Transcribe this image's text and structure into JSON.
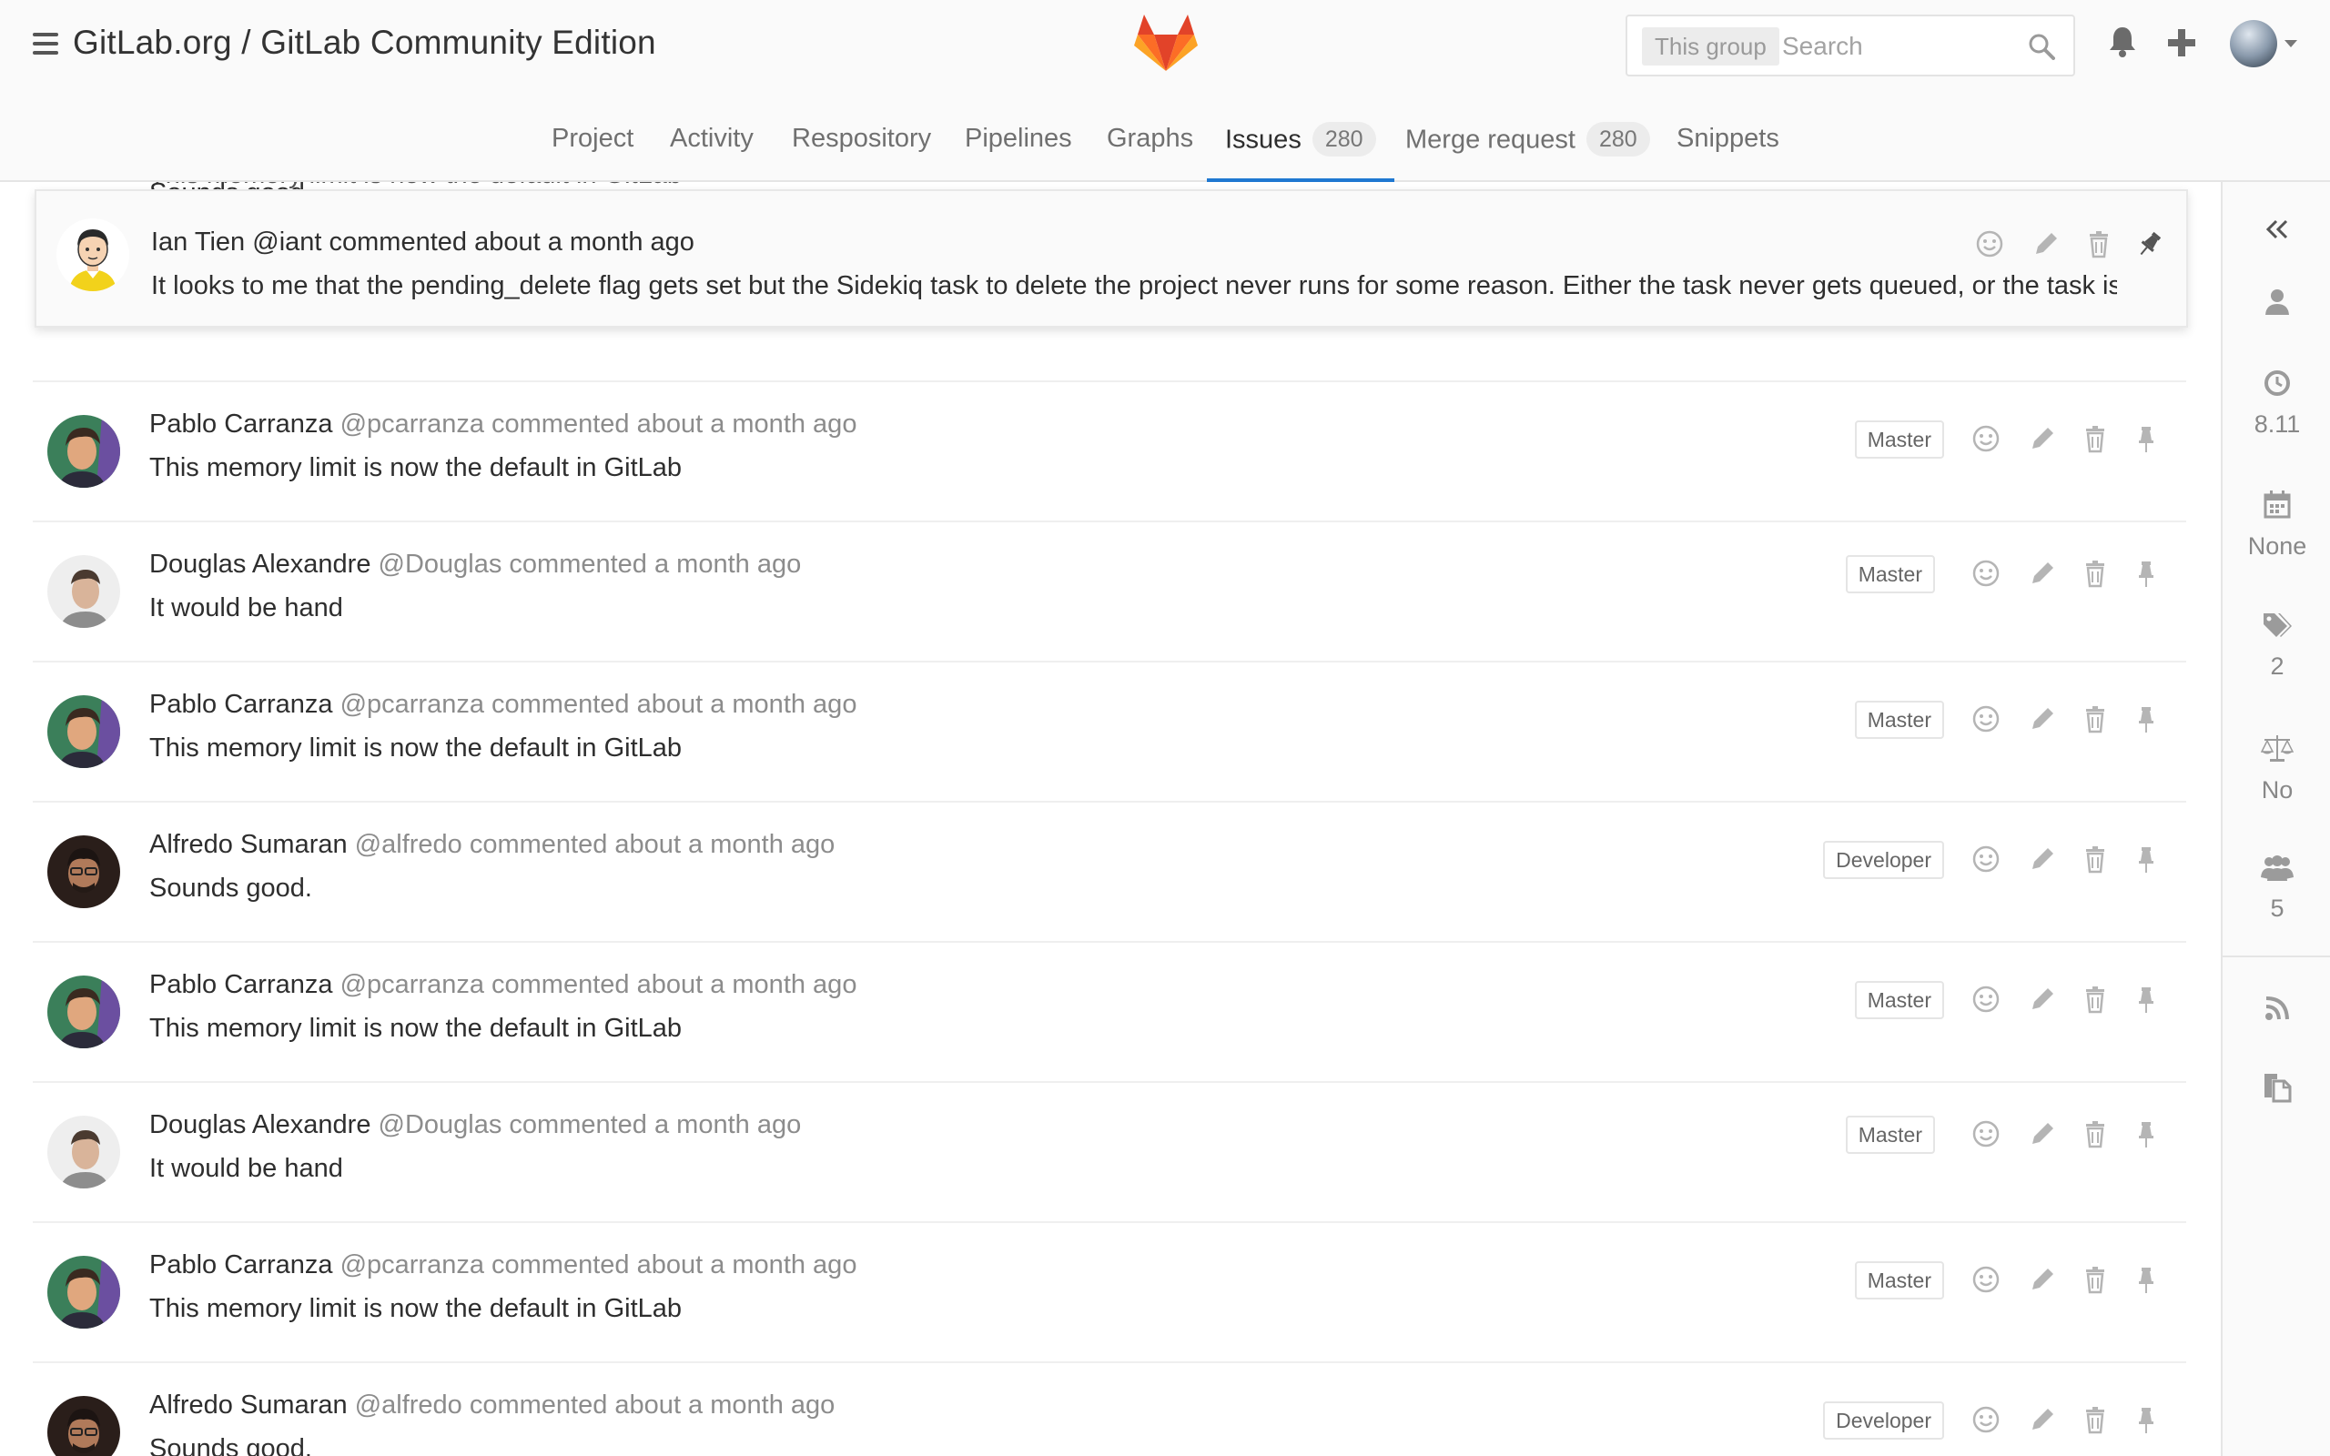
{
  "header": {
    "breadcrumb": "GitLab.org / GitLab Community Edition",
    "search": {
      "scope": "This group",
      "placeholder": "Search"
    }
  },
  "nav": {
    "tabs": [
      {
        "label": "Project"
      },
      {
        "label": "Activity"
      },
      {
        "label": "Respository"
      },
      {
        "label": "Pipelines"
      },
      {
        "label": "Graphs"
      },
      {
        "label": "Issues",
        "count": "280",
        "active": true
      },
      {
        "label": "Merge request",
        "count": "280"
      },
      {
        "label": "Snippets"
      }
    ]
  },
  "pinned_note": {
    "author": "Ian Tien",
    "meta": "@iant commented about a month ago",
    "body": "It looks to me that the pending_delete flag gets set but the Sidekiq task to delete the project never runs for some reason. Either the task never gets queued, or the task is..."
  },
  "behind_text": {
    "top": "This memory limit is now the default in GitLab",
    "second": "Sounds good."
  },
  "notes": [
    {
      "author": "Pablo Carranza",
      "meta": "@pcarranza commented about a month ago",
      "body": "This memory limit is now the default in GitLab",
      "role": "Master"
    },
    {
      "author": "Douglas Alexandre",
      "meta": "@Douglas commented a month ago",
      "body": "It would be hand",
      "role": "Master"
    },
    {
      "author": "Pablo Carranza",
      "meta": "@pcarranza commented about a month ago",
      "body": "This memory limit is now the default in GitLab",
      "role": "Master"
    },
    {
      "author": "Alfredo Sumaran",
      "meta": "@alfredo commented about a month ago",
      "body": "Sounds good.",
      "role": "Developer"
    },
    {
      "author": "Pablo Carranza",
      "meta": "@pcarranza commented about a month ago",
      "body": "This memory limit is now the default in GitLab",
      "role": "Master"
    },
    {
      "author": "Douglas Alexandre",
      "meta": "@Douglas commented a month ago",
      "body": "It would be hand",
      "role": "Master"
    },
    {
      "author": "Pablo Carranza",
      "meta": "@pcarranza commented about a month ago",
      "body": "This memory limit is now the default in GitLab",
      "role": "Master"
    },
    {
      "author": "Alfredo Sumaran",
      "meta": "@alfredo commented about a month ago",
      "body": "Sounds good.",
      "role": "Developer"
    }
  ],
  "sidebar": {
    "milestone": "8.11",
    "due_date": "None",
    "labels": "2",
    "weight": "No",
    "participants": "5"
  },
  "icons": {
    "header": [
      "menu-icon",
      "gitlab-logo",
      "search-icon",
      "bell-icon",
      "plus-icon",
      "avatar"
    ],
    "note_actions": [
      "emoji-icon",
      "pencil-icon",
      "trash-icon",
      "pin-icon"
    ],
    "sidebar": [
      "collapse-icon",
      "assignee-icon",
      "clock-icon",
      "calendar-icon",
      "tag-icon",
      "scale-icon",
      "users-icon",
      "rss-icon",
      "copy-icon"
    ]
  },
  "colors": {
    "accent": "#1f78d1",
    "logo_orange": "#fc6d26",
    "logo_red": "#e24329",
    "logo_light": "#fca326"
  }
}
